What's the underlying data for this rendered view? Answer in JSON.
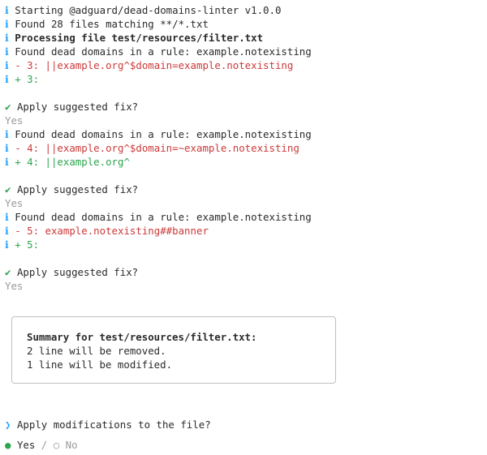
{
  "glyphs": {
    "info": "ℹ",
    "check": "✔",
    "prompt": "❯",
    "bullet_filled": "●",
    "bullet_open": "○",
    "sep": "/"
  },
  "log": {
    "start": "Starting @adguard/dead-domains-linter v1.0.0",
    "found_files": "Found 28 files matching **/*.txt",
    "processing": "Processing file test/resources/filter.txt",
    "found_dead": "Found dead domains in a rule: example.notexisting",
    "diff1_minus": "- 3: ||example.org^$domain=example.notexisting",
    "diff1_plus": "+ 3:",
    "apply_q": "Apply suggested fix?",
    "yes": "Yes",
    "diff2_minus": "- 4: ||example.org^$domain=~example.notexisting",
    "diff2_plus": "+ 4: ||example.org^",
    "diff3_minus": "- 5: example.notexisting##banner",
    "diff3_plus": "+ 5:"
  },
  "summary": {
    "title": "Summary for test/resources/filter.txt:",
    "removed": "2 line will be removed.",
    "modified": "1 line will be modified."
  },
  "final": {
    "question": "Apply modifications to the file?",
    "yes": "Yes",
    "no": "No"
  }
}
